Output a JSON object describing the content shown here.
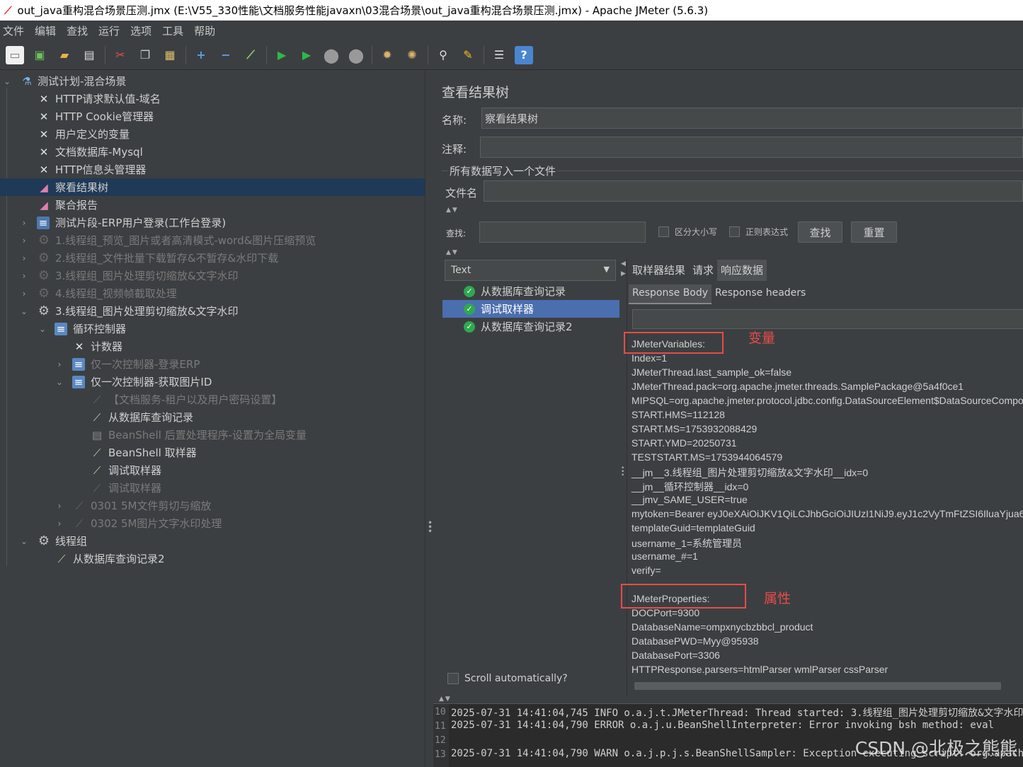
{
  "window": {
    "title": "out_java重构混合场景压测.jmx (E:\\V55_330性能\\文档服务性能javaxn\\03混合场景\\out_java重构混合场景压测.jmx) - Apache JMeter (5.6.3)"
  },
  "menu": [
    "文件",
    "编辑",
    "查找",
    "运行",
    "选项",
    "工具",
    "帮助"
  ],
  "toolbar_icons": [
    "new-icon",
    "templates-icon",
    "open-icon",
    "save-icon",
    "cut-icon",
    "copy-icon",
    "paste-icon",
    "expand-icon",
    "collapse-icon",
    "toggle-icon",
    "start-icon",
    "start-no-pause-icon",
    "stop-icon",
    "shutdown-icon",
    "clear-icon",
    "clear-all-icon",
    "search-icon",
    "reset-search-icon",
    "function-helper-icon",
    "help-icon"
  ],
  "tree": [
    {
      "label": "测试计划-混合场景",
      "toggle": "⌄",
      "icon": "flask",
      "disabled": false
    },
    {
      "label": "HTTP请求默认值-域名",
      "icon": "tool",
      "disabled": false
    },
    {
      "label": "HTTP Cookie管理器",
      "icon": "tool",
      "disabled": false
    },
    {
      "label": "用户定义的变量",
      "icon": "tool",
      "disabled": false
    },
    {
      "label": "文档数据库-Mysql",
      "icon": "tool",
      "disabled": false
    },
    {
      "label": "HTTP信息头管理器",
      "icon": "tool",
      "disabled": false
    },
    {
      "label": "察看结果树",
      "icon": "chart",
      "disabled": false,
      "selected": true
    },
    {
      "label": "聚合报告",
      "icon": "chart",
      "disabled": false
    },
    {
      "label": "测试片段-ERP用户登录(工作台登录)",
      "toggle": "›",
      "icon": "frag",
      "disabled": false
    },
    {
      "label": "1.线程组_预览_图片或者高清模式-word&图片压缩预览",
      "toggle": "›",
      "icon": "gear",
      "disabled": true
    },
    {
      "label": "2.线程组_文件批量下载暂存&不暂存&水印下载",
      "toggle": "›",
      "icon": "gear",
      "disabled": true
    },
    {
      "label": "3.线程组_图片处理剪切缩放&文字水印",
      "toggle": "›",
      "icon": "gear",
      "disabled": true
    },
    {
      "label": "4.线程组_视频帧截取处理",
      "toggle": "›",
      "icon": "gear",
      "disabled": true
    },
    {
      "label": "3.线程组_图片处理剪切缩放&文字水印",
      "toggle": "⌄",
      "icon": "gear",
      "disabled": false
    },
    {
      "label": "循环控制器",
      "toggle": "⌄",
      "icon": "loop",
      "disabled": false
    },
    {
      "label": "计数器",
      "icon": "tool",
      "disabled": false
    },
    {
      "label": "仅一次控制器-登录ERP",
      "toggle": "›",
      "icon": "loop",
      "disabled": true
    },
    {
      "label": "仅一次控制器-获取图片ID",
      "toggle": "⌄",
      "icon": "loop",
      "disabled": false
    },
    {
      "label": "【文档服务-租户以及用户密码设置】",
      "icon": "pen",
      "disabled": true
    },
    {
      "label": "从数据库查询记录",
      "icon": "pen",
      "disabled": false
    },
    {
      "label": "BeanShell 后置处理程序-设置为全局变量",
      "icon": "doc",
      "disabled": true
    },
    {
      "label": "BeanShell 取样器",
      "icon": "pen",
      "disabled": false
    },
    {
      "label": "调试取样器",
      "icon": "pen",
      "disabled": false
    },
    {
      "label": "调试取样器",
      "icon": "pen",
      "disabled": true
    },
    {
      "label": "0301 5M文件剪切与缩放",
      "toggle": "›",
      "icon": "pen",
      "disabled": true
    },
    {
      "label": "0302 5M图片文字水印处理",
      "toggle": "›",
      "icon": "pen",
      "disabled": true
    },
    {
      "label": "线程组",
      "toggle": "⌄",
      "icon": "gear",
      "disabled": false
    },
    {
      "label": "从数据库查询记录2",
      "icon": "pen",
      "disabled": false
    }
  ],
  "panel": {
    "title": "查看结果树",
    "name_label": "名称:",
    "name_value": "察看结果树",
    "comment_label": "注释:",
    "comment_value": "",
    "file_section": "所有数据写入一个文件",
    "filename_label": "文件名",
    "filename_value": "",
    "search_label": "查找:",
    "search_value": "",
    "case_sensitive": "区分大小写",
    "regex": "正则表达式",
    "find_button": "查找",
    "reset_button": "重置",
    "renderer": "Text",
    "results": [
      {
        "label": "从数据库查询记录",
        "selected": false
      },
      {
        "label": "调试取样器",
        "selected": true
      },
      {
        "label": "从数据库查询记录2",
        "selected": false
      }
    ],
    "tabs": [
      "取样器结果",
      "请求",
      "响应数据"
    ],
    "subtabs": [
      "Response Body",
      "Response headers"
    ],
    "scroll_auto": "Scroll automatically?"
  },
  "response_lines": [
    "JMeterVariables:",
    "Index=1",
    "JMeterThread.last_sample_ok=false",
    "JMeterThread.pack=org.apache.jmeter.threads.SamplePackage@5a4f0ce1",
    "MIPSQL=org.apache.jmeter.protocol.jdbc.config.DataSourceElement$DataSourceComponentImpl",
    "START.HMS=112128",
    "START.MS=1753932088429",
    "START.YMD=20250731",
    "TESTSTART.MS=1753944064579",
    "__jm__3.线程组_图片处理剪切缩放&文字水印__idx=0",
    "__jm__循环控制器__idx=0",
    "__jmv_SAME_USER=true",
    "mytoken=Bearer eyJ0eXAiOiJKV1QiLCJhbGciOiJIUzI1NiJ9.eyJ1c2VyTmFtZSI6IluaYjua6f",
    "templateGuid=templateGuid",
    "username_1=系统管理员",
    "username_#=1",
    "verify=",
    "",
    "JMeterProperties:",
    "DOCPort=9300",
    "DatabaseName=ompxnycbzbbcl_product",
    "DatabasePWD=Myy@95938",
    "DatabasePort=3306",
    "HTTPResponse.parsers=htmlParser wmlParser cssParser"
  ],
  "annotations": {
    "variables": "变量",
    "properties": "属性"
  },
  "log": [
    {
      "n": "10",
      "text": "2025-07-31 14:41:04,745 INFO o.a.j.t.JMeterThread: Thread started: 3.线程组_图片处理剪切缩放&文字水印"
    },
    {
      "n": "11",
      "text": "2025-07-31 14:41:04,790 ERROR o.a.j.u.BeanShellInterpreter: Error invoking bsh method: eval"
    },
    {
      "n": "12",
      "text": ""
    },
    {
      "n": "13",
      "text": "2025-07-31 14:41:04,790 WARN o.a.j.p.j.s.BeanShellSampler: Exception executing script: org.apache"
    }
  ],
  "watermark": "CSDN @北极之熊熊"
}
